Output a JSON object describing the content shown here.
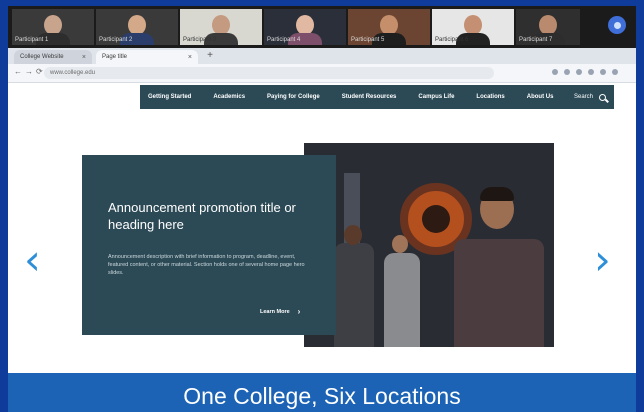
{
  "video_call": {
    "participants": [
      {
        "name": "Participant 1"
      },
      {
        "name": "Participant 2"
      },
      {
        "name": "Participant 3"
      },
      {
        "name": "Participant 4"
      },
      {
        "name": "Participant 5"
      },
      {
        "name": "Participant 6"
      },
      {
        "name": "Participant 7"
      }
    ]
  },
  "browser": {
    "tabs": [
      {
        "label": "College Website"
      },
      {
        "label": "Page title"
      }
    ],
    "url": "www.college.edu"
  },
  "site_nav": {
    "items": [
      {
        "label": "Getting Started"
      },
      {
        "label": "Academics"
      },
      {
        "label": "Paying for College"
      },
      {
        "label": "Student Resources"
      },
      {
        "label": "Campus Life"
      },
      {
        "label": "Locations"
      },
      {
        "label": "About Us"
      }
    ],
    "search_label": "Search"
  },
  "hero": {
    "title": "Announcement promotion title or heading here",
    "description": "Announcement description with brief information to program, deadline, event, featured content, or other material. Section holds one of several home page hero slides.",
    "cta": "Learn More",
    "prev_icon": "‹",
    "next_icon": "›"
  },
  "banner": {
    "text": "One College, Six Locations"
  },
  "colors": {
    "nav_bg": "#2c4a56",
    "banner_bg": "#1c63b5",
    "arrow": "#2e8fd8",
    "frame": "#0f3b9a"
  }
}
